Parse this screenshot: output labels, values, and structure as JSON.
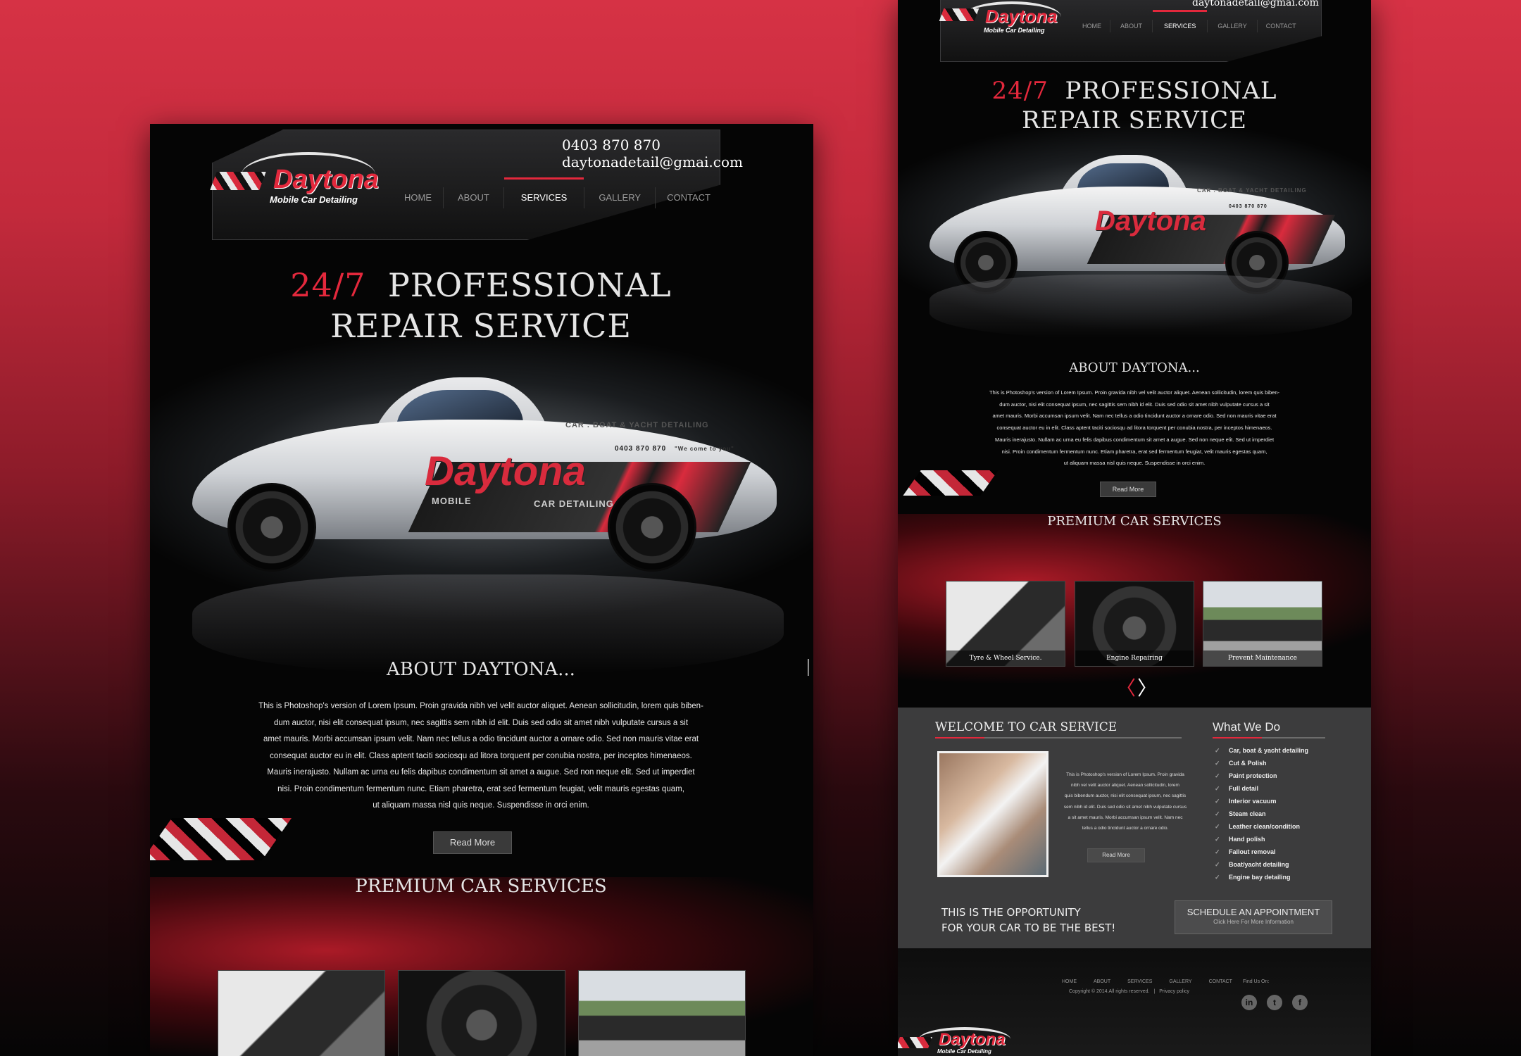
{
  "colors": {
    "accent": "#e3283c",
    "background_top": "#d63245",
    "panel": "#050505",
    "welcome_bg": "#3c3c3d"
  },
  "site": {
    "brand_name": "Daytona",
    "brand_tagline": "Mobile Car Detailing",
    "phone": "0403 870 870",
    "email": "daytonadetail@gmai.com",
    "nav": [
      "HOME",
      "ABOUT",
      "SERVICES",
      "GALLERY",
      "CONTACT"
    ],
    "active_nav": "SERVICES"
  },
  "hero": {
    "highlight": "24/7",
    "title_line1": "PROFESSIONAL",
    "title_line2": "REPAIR SERVICE"
  },
  "car_decal": {
    "brand": "Daytona",
    "mobile": "MOBILE",
    "detailing": "CAR DETAILING",
    "phone": "0403 870 870",
    "slogan": "\"We come to you\"",
    "top": "CAR . BOAT & YACHT DETAILING"
  },
  "about": {
    "title": "ABOUT DAYTONA...",
    "lines": [
      "This is Photoshop's version  of Lorem Ipsum. Proin gravida nibh vel velit auctor aliquet. Aenean sollicitudin, lorem quis biben-",
      "dum auctor, nisi elit consequat ipsum, nec sagittis sem nibh id elit. Duis sed odio sit amet nibh vulputate cursus a sit",
      "amet mauris. Morbi accumsan ipsum velit. Nam nec tellus a odio tincidunt auctor a ornare odio. Sed non  mauris vitae erat",
      "consequat auctor eu in elit. Class aptent taciti sociosqu ad litora torquent per conubia nostra, per inceptos himenaeos.",
      "Mauris inerajusto. Nullam ac urna eu felis dapibus condimentum sit amet a augue. Sed non neque elit. Sed ut imperdiet",
      "nisi. Proin condimentum fermentum nunc. Etiam pharetra, erat sed fermentum feugiat, velit mauris egestas quam,",
      "ut aliquam massa nisl quis neque. Suspendisse in orci enim."
    ],
    "button": "Read More"
  },
  "services": {
    "title": "PREMIUM CAR SERVICES",
    "items": [
      "Tyre & Wheel Service.",
      "Engine Repairing",
      "Prevent Maintenance"
    ],
    "prev_arrow": "〈",
    "next_arrow": "〉"
  },
  "welcome": {
    "title": "WELCOME TO CAR SERVICE",
    "lines": [
      "This is Photoshop's version  of Lorem Ipsum. Proin gravida",
      "nibh vel velit auctor aliquet. Aenean sollicitudin, lorem",
      "quis bibendum auctor, nisi elit consequat ipsum, nec sagittis",
      "sem nibh id elit. Duis sed odio sit amet nibh vulputate cursus",
      "a sit amet mauris. Morbi accumsan ipsum velit. Nam nec",
      "tellus a odio tincidunt auctor a ornare odio."
    ],
    "button": "Read More"
  },
  "what_we_do": {
    "title": "What We Do",
    "items": [
      "Car, boat & yacht detailing",
      "Cut & Polish",
      "Paint protection",
      "Full detail",
      "Interior vacuum",
      "Steam clean",
      "Leather clean/condition",
      "Hand polish",
      "Fallout removal",
      "Boat/yacht detailing",
      "Engine bay detailing"
    ]
  },
  "cta": {
    "line1": "THIS IS THE OPPORTUNITY",
    "line2": "FOR YOUR CAR TO BE THE BEST!",
    "schedule_title": "SCHEDULE AN APPOINTMENT",
    "schedule_sub": "Click Here For More Information"
  },
  "footer": {
    "nav": [
      "HOME",
      "ABOUT",
      "SERVICES",
      "GALLERY",
      "CONTACT"
    ],
    "copyright": "Copyright © 2014.All rights reserved.",
    "privacy": "Privacy policy",
    "separator": "|",
    "find_us": "Find Us On:",
    "social": [
      "in",
      "t",
      "f"
    ],
    "social_icons": [
      "linkedin-icon",
      "twitter-icon",
      "facebook-icon"
    ]
  }
}
